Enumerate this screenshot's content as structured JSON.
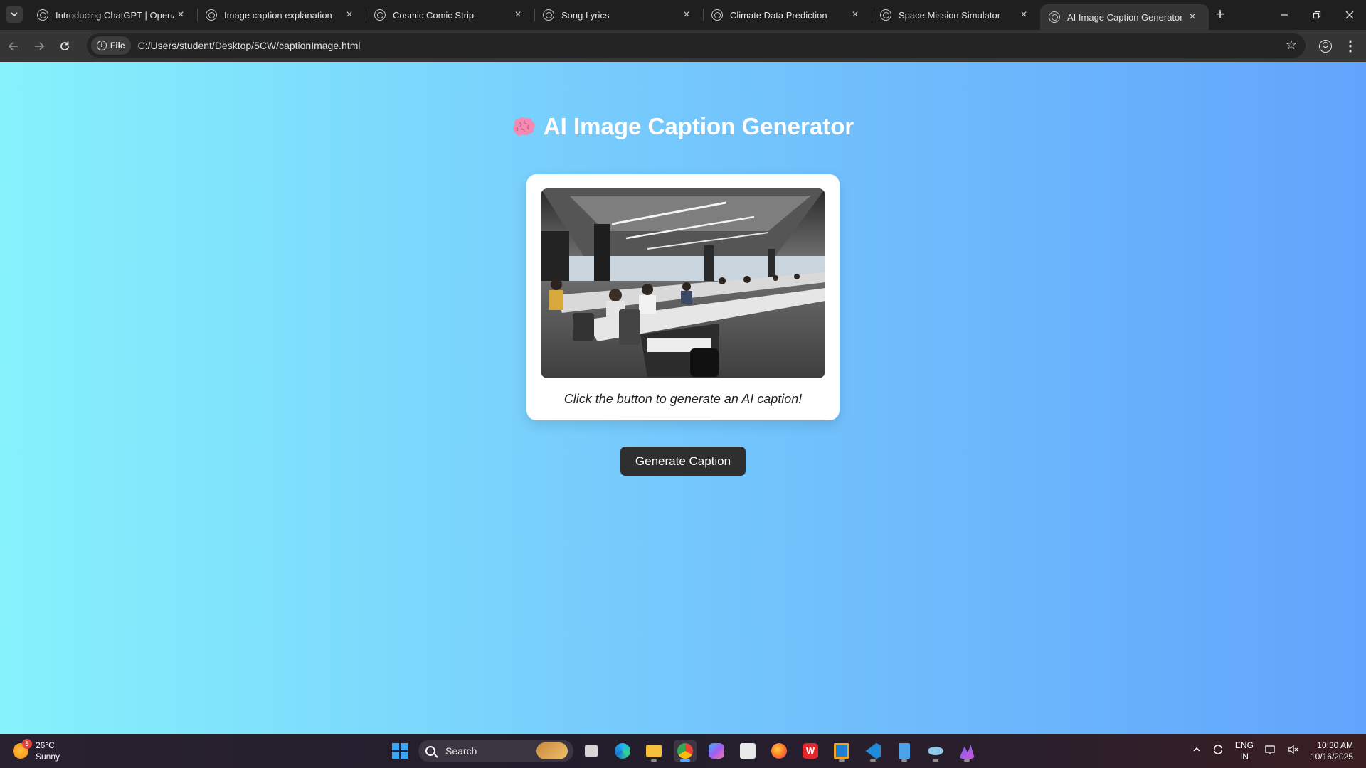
{
  "browser": {
    "tabs": [
      {
        "title": "Introducing ChatGPT | OpenAI",
        "active": false
      },
      {
        "title": "Image caption explanation",
        "active": false
      },
      {
        "title": "Cosmic Comic Strip",
        "active": false
      },
      {
        "title": "Song Lyrics",
        "active": false
      },
      {
        "title": "Climate Data Prediction",
        "active": false
      },
      {
        "title": "Space Mission Simulator",
        "active": false
      },
      {
        "title": "AI Image Caption Generator",
        "active": true
      }
    ],
    "site_chip": "File",
    "url": "C:/Users/student/Desktop/5CW/captionImage.html"
  },
  "page": {
    "title": "AI Image Caption Generator",
    "title_icon": "brain-icon",
    "image_icon": "office-photo",
    "caption": "Click the button to generate an AI caption!",
    "button_label": "Generate Caption",
    "gradient_colors": [
      "#86f2fc",
      "#62a4fc"
    ]
  },
  "taskbar": {
    "weather": {
      "temp": "26°C",
      "condition": "Sunny",
      "badge": "5"
    },
    "search_label": "Search",
    "language": {
      "line1": "ENG",
      "line2": "IN"
    },
    "clock": {
      "time": "10:30 AM",
      "date": "10/16/2025"
    },
    "apps": [
      "task-view",
      "edge",
      "file-explorer",
      "chrome",
      "copilot",
      "store",
      "firefox",
      "wps-office",
      "remote-desktop",
      "vscode",
      "notepad",
      "app-blue",
      "app-purple"
    ]
  }
}
